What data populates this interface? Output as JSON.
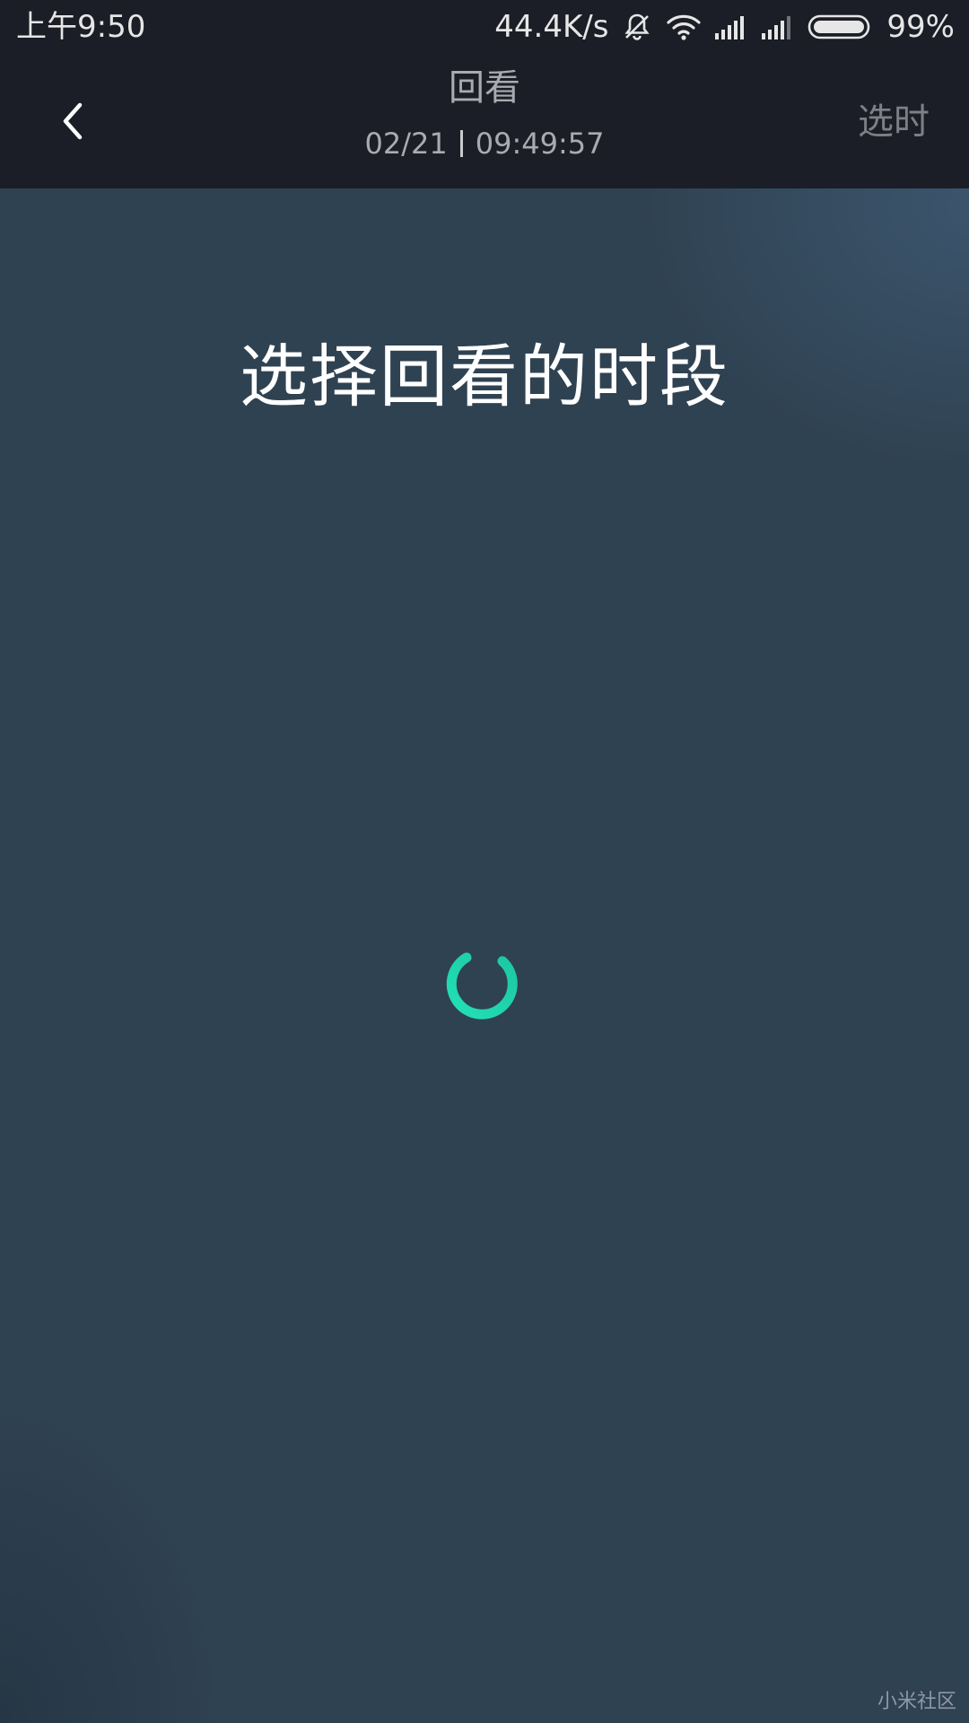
{
  "status_bar": {
    "time": "上午9:50",
    "network_speed": "44.4K/s",
    "battery_percent": "99%",
    "icons": [
      "mute-bell-icon",
      "wifi-icon",
      "signal-icon",
      "signal-icon",
      "battery-icon"
    ]
  },
  "header": {
    "back_icon": "chevron-left-icon",
    "title": "回看",
    "date": "02/21",
    "time": "09:49:57",
    "select_time_label": "选时"
  },
  "main": {
    "heading": "选择回看的时段",
    "spinner_icon": "loading-spinner-icon",
    "watermark": "小米社区"
  },
  "colors": {
    "bar_background": "#1b1e26",
    "content_background": "#2f4252",
    "accent": "#22d8b0",
    "secondary_text": "#a9abb0"
  }
}
